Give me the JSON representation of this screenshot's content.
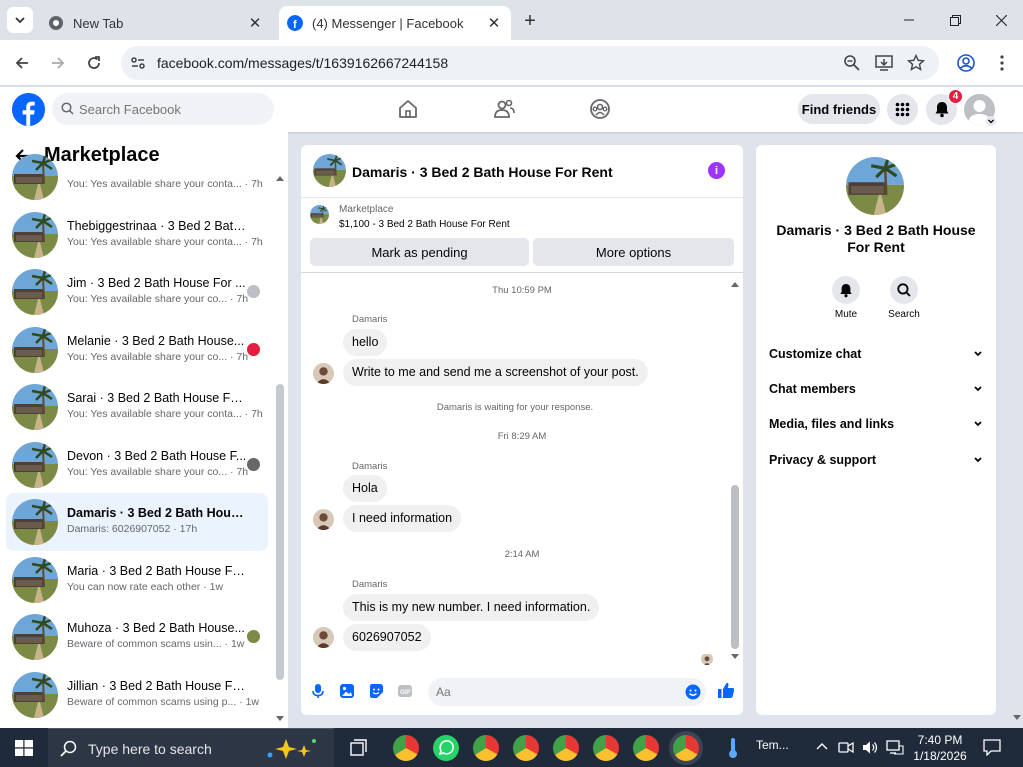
{
  "browser": {
    "tabs": [
      {
        "title": "New Tab",
        "active": false
      },
      {
        "title": "(4) Messenger | Facebook",
        "active": true
      }
    ],
    "url": "facebook.com/messages/t/1639162667244158"
  },
  "fb_header": {
    "search_placeholder": "Search Facebook",
    "find_friends": "Find friends",
    "notification_count": "4"
  },
  "sidebar": {
    "title": "Marketplace",
    "conversations": [
      {
        "name": "",
        "preview": "You: Yes available share your conta... · 7h",
        "selected": false
      },
      {
        "name": "Thebiggestrinaa · 3 Bed 2 Bath ...",
        "preview": "You: Yes available share your conta... · 7h",
        "selected": false
      },
      {
        "name": "Jim · 3 Bed 2 Bath House For ...",
        "preview": "You: Yes available share your co... · 7h",
        "selected": false
      },
      {
        "name": "Melanie · 3 Bed 2 Bath House...",
        "preview": "You: Yes available share your co... · 7h",
        "selected": false
      },
      {
        "name": "Sarai · 3 Bed 2 Bath House For ...",
        "preview": "You: Yes available share your conta... · 7h",
        "selected": false
      },
      {
        "name": "Devon · 3 Bed 2 Bath House F...",
        "preview": "You: Yes available share your co... · 7h",
        "selected": false
      },
      {
        "name": "Damaris · 3 Bed 2 Bath House F...",
        "preview": "Damaris: 6026907052 · 17h",
        "selected": true
      },
      {
        "name": "Maria · 3 Bed 2 Bath House For ...",
        "preview": "You can now rate each other · 1w",
        "selected": false
      },
      {
        "name": "Muhoza · 3 Bed 2 Bath House...",
        "preview": "Beware of common scams usin... · 1w",
        "selected": false
      },
      {
        "name": "Jillian · 3 Bed 2 Bath House For ...",
        "preview": "Beware of common scams using p... · 1w",
        "selected": false
      }
    ]
  },
  "chat": {
    "title": "Damaris · 3 Bed 2 Bath House For Rent",
    "marketplace_label": "Marketplace",
    "listing": "$1,100 - 3 Bed 2 Bath House For Rent",
    "mark_pending": "Mark as pending",
    "more_options": "More options",
    "timestamps": [
      "Thu 10:59 PM",
      "Fri 8:29 AM",
      "2:14 AM"
    ],
    "sender": "Damaris",
    "messages_1": [
      "hello",
      "Write to me and send me a screenshot of your post."
    ],
    "waiting": "Damaris is waiting for your response.",
    "messages_2": [
      "Hola",
      "I need information"
    ],
    "messages_3": [
      "This is my new number. I need information.",
      "6026907052"
    ],
    "composer_placeholder": "Aa"
  },
  "right_panel": {
    "title": "Damaris · 3 Bed 2 Bath House For Rent",
    "actions": [
      {
        "label": "Mute",
        "icon": "bell-icon"
      },
      {
        "label": "Search",
        "icon": "search-icon"
      }
    ],
    "sections": [
      "Customize chat",
      "Chat members",
      "Media, files and links",
      "Privacy & support"
    ]
  },
  "taskbar": {
    "search_text": "Type here to search",
    "weather": "Tem...",
    "time": "7:40 PM",
    "date": "1/18/2026"
  },
  "colors": {
    "fb_blue": "#0866ff",
    "messenger_purple": "#a033ff",
    "badge_red": "#e41e3f",
    "selected_row": "#ebf3ff"
  }
}
